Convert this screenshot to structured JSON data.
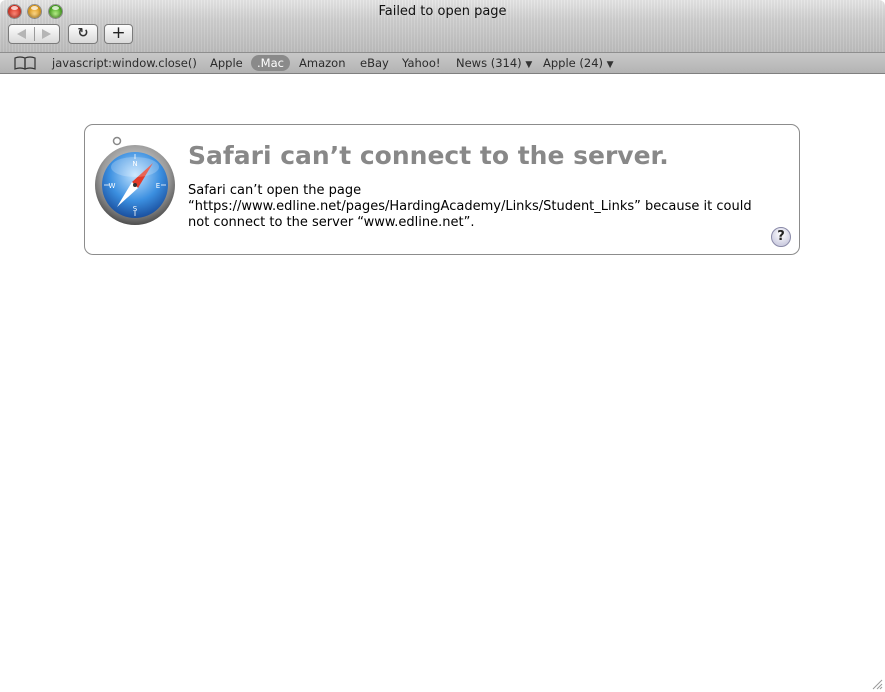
{
  "window": {
    "title": "Failed to open page"
  },
  "toolbar": {
    "reload_glyph": "↻",
    "add_glyph": "+"
  },
  "bookmarks": [
    {
      "label": "javascript:window.close()",
      "active": false,
      "menu": false
    },
    {
      "label": "Apple",
      "active": false,
      "menu": false
    },
    {
      "label": ".Mac",
      "active": true,
      "menu": false
    },
    {
      "label": "Amazon",
      "active": false,
      "menu": false
    },
    {
      "label": "eBay",
      "active": false,
      "menu": false
    },
    {
      "label": "Yahoo!",
      "active": false,
      "menu": false
    },
    {
      "label": "News (314)",
      "active": false,
      "menu": true
    },
    {
      "label": "Apple (24)",
      "active": false,
      "menu": true
    }
  ],
  "error": {
    "title": "Safari can’t connect to the server.",
    "line1": "Safari can’t open the page",
    "line2": "“https://www.edline.net/pages/HardingAcademy/Links/Student_Links” because it could",
    "line3": "not connect to the server “www.edline.net”.",
    "help_label": "?"
  },
  "icons": {
    "app": "safari-compass-icon",
    "bookmarks": "book-icon",
    "help": "help-icon"
  },
  "colors": {
    "title_gray": "#888888",
    "bookmark_bar": "#bdbdbd",
    "active_bookmark": "#8a8a8a"
  }
}
